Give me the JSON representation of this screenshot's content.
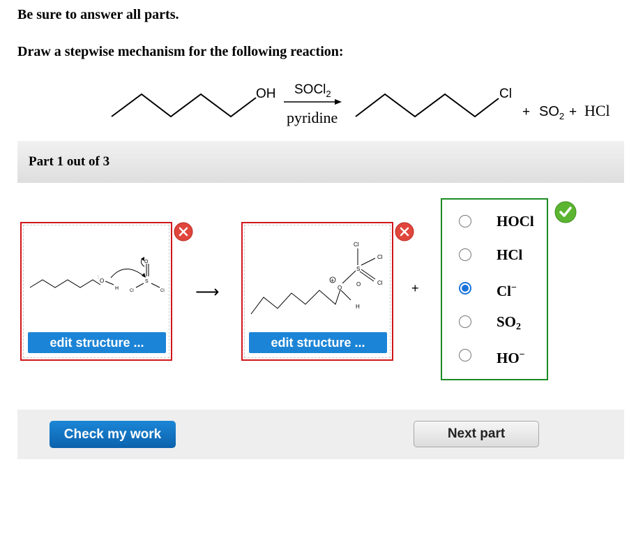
{
  "instructions": {
    "line1": "Be sure to answer all parts.",
    "line2": "Draw a stepwise mechanism for the following reaction:"
  },
  "reaction": {
    "reactant_group": "OH",
    "reagent_above": "SOCl",
    "reagent_above_sub": "2",
    "reagent_below": "pyridine",
    "product_group": "Cl",
    "plus1": "+",
    "so2": "SO",
    "so2_sub": "2",
    "plus2": "+",
    "hcl": "HCl"
  },
  "part": {
    "label": "Part 1 out of 3"
  },
  "step": {
    "structure1": {
      "edit_label": "edit structure ...",
      "atoms": {
        "o": "O",
        "h": "H",
        "s": "S",
        "o2": "O",
        "cl": "Cl",
        "cl2": "Cl"
      }
    },
    "arrow": "⟶",
    "structure2": {
      "edit_label": "edit structure ...",
      "atoms": {
        "cl_top": "Cl",
        "cl_mid": "Cl",
        "cl_low": "Cl",
        "s": "S",
        "o_link": "O",
        "o_eq": "O",
        "plus": "+",
        "h": "H"
      }
    },
    "plus": "+"
  },
  "choices": {
    "selected": "Cl−",
    "options": [
      {
        "base": "HOCl",
        "sub": "",
        "sup": ""
      },
      {
        "base": "HCl",
        "sub": "",
        "sup": ""
      },
      {
        "base": "Cl",
        "sub": "",
        "sup": "−"
      },
      {
        "base": "SO",
        "sub": "2",
        "sup": ""
      },
      {
        "base": "HO",
        "sub": "",
        "sup": "−"
      }
    ]
  },
  "footer": {
    "check_label": "Check my work",
    "next_label": "Next part"
  },
  "colors": {
    "wrong_border": "#d0161a",
    "correct_border": "#1b8b23",
    "primary_button": "#1c84d6",
    "radio_selected": "#1a73d9"
  },
  "icons": {
    "remove": "close-icon",
    "correct": "check-icon"
  }
}
